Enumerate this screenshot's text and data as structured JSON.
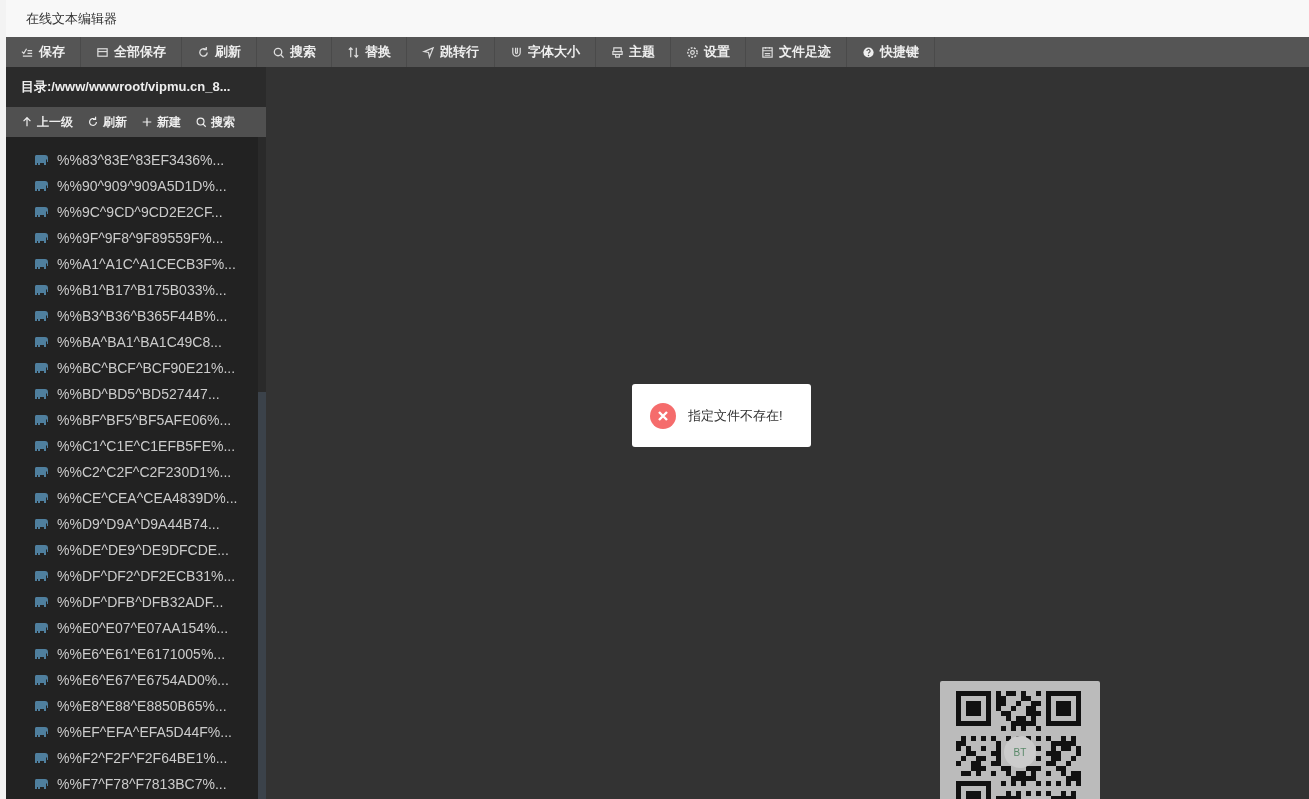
{
  "window": {
    "title": "在线文本编辑器"
  },
  "toolbar": [
    {
      "label": "保存"
    },
    {
      "label": "全部保存"
    },
    {
      "label": "刷新"
    },
    {
      "label": "搜索"
    },
    {
      "label": "替换"
    },
    {
      "label": "跳转行"
    },
    {
      "label": "字体大小"
    },
    {
      "label": "主题"
    },
    {
      "label": "设置"
    },
    {
      "label": "文件足迹"
    },
    {
      "label": "快捷键"
    }
  ],
  "sidebar": {
    "directory_label": "目录:",
    "directory_path": "/www/wwwroot/vipmu.cn_8...",
    "actions": [
      {
        "label": "上一级"
      },
      {
        "label": "刷新"
      },
      {
        "label": "新建"
      },
      {
        "label": "搜索"
      }
    ],
    "files": [
      {
        "name": "%%83^83E^83EF3436%..."
      },
      {
        "name": "%%90^909^909A5D1D%..."
      },
      {
        "name": "%%9C^9CD^9CD2E2CF..."
      },
      {
        "name": "%%9F^9F8^9F89559F%..."
      },
      {
        "name": "%%A1^A1C^A1CECB3F%..."
      },
      {
        "name": "%%B1^B17^B175B033%..."
      },
      {
        "name": "%%B3^B36^B365F44B%..."
      },
      {
        "name": "%%BA^BA1^BA1C49C8..."
      },
      {
        "name": "%%BC^BCF^BCF90E21%..."
      },
      {
        "name": "%%BD^BD5^BD527447..."
      },
      {
        "name": "%%BF^BF5^BF5AFE06%..."
      },
      {
        "name": "%%C1^C1E^C1EFB5FE%..."
      },
      {
        "name": "%%C2^C2F^C2F230D1%..."
      },
      {
        "name": "%%CE^CEA^CEA4839D%..."
      },
      {
        "name": "%%D9^D9A^D9A44B74..."
      },
      {
        "name": "%%DE^DE9^DE9DFCDE..."
      },
      {
        "name": "%%DF^DF2^DF2ECB31%..."
      },
      {
        "name": "%%DF^DFB^DFB32ADF..."
      },
      {
        "name": "%%E0^E07^E07AA154%..."
      },
      {
        "name": "%%E6^E61^E6171005%..."
      },
      {
        "name": "%%E6^E67^E6754AD0%..."
      },
      {
        "name": "%%E8^E88^E8850B65%..."
      },
      {
        "name": "%%EF^EFA^EFA5D44F%..."
      },
      {
        "name": "%%F2^F2F^F2F64BE1%..."
      },
      {
        "name": "%%F7^F78^F7813BC7%..."
      }
    ]
  },
  "toast": {
    "kind": "error",
    "message": "指定文件不存在!"
  },
  "qr_code": {
    "logo_text": "BT"
  }
}
